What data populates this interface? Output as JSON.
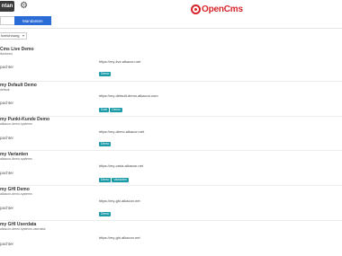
{
  "header": {
    "app_button_label": "ntan",
    "gear_icon": "gear-icon",
    "logo_text": "OpenCms",
    "logo_color": "#d6242a"
  },
  "tabs": [
    {
      "label": "",
      "active": false
    },
    {
      "label": "Mandanten",
      "active": true
    }
  ],
  "sort_select": {
    "value": "hzeichnung"
  },
  "sites": [
    {
      "title": "Cms Live Demo",
      "subtitle": "livedemo",
      "label": "pachter",
      "url": "https://my-live.alkacon.net",
      "badges": [
        "Demo"
      ]
    },
    {
      "title": "my Default Demo",
      "subtitle": "default",
      "label": "pachter",
      "url": "https://my-default-demo.alkacon.com",
      "badges": [
        "Dole",
        "Demo"
      ]
    },
    {
      "title": "my Punkt-Kunde Demo",
      "subtitle": "alkacon-demo.systems",
      "label": "pachter",
      "url": "https://my-demo.alkacon.net",
      "badges": [
        "Demo"
      ]
    },
    {
      "title": "my Varianten",
      "subtitle": "alkacon-demo.systems",
      "label": "pachter",
      "url": "https://my-varia.alkacon.net",
      "badges": [
        "Demo",
        "Varianten"
      ]
    },
    {
      "title": "my GHI Demo",
      "subtitle": "alkacon-demo.systems",
      "label": "pachter",
      "url": "https://my-ghi.alkacon.net",
      "badges": [
        "Demo"
      ]
    },
    {
      "title": "my GHI Userdata",
      "subtitle": "alkacon-demo.systems.userdata",
      "label": "pachter",
      "url": "https://my-ghi.alkacon.net",
      "badges": []
    }
  ]
}
